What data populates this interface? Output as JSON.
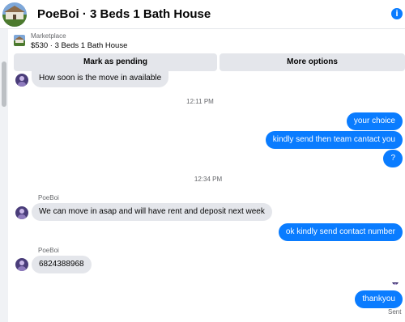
{
  "header": {
    "title": "PoeBoi · 3 Beds 1 Bath House",
    "info_icon": "info-icon"
  },
  "listing": {
    "kicker": "Marketplace",
    "title": "$530 · 3 Beds 1 Bath House"
  },
  "actions": {
    "pending": "Mark as pending",
    "more": "More options"
  },
  "messages": [
    {
      "dir": "in",
      "text": "How soon is the move in available"
    },
    {
      "time": "12:11 PM"
    },
    {
      "dir": "out",
      "text": "your choice"
    },
    {
      "dir": "out",
      "text": "kindly send then team cantact you"
    },
    {
      "dir": "out",
      "text": "?"
    },
    {
      "time": "12:34 PM"
    },
    {
      "sender": "PoeBoi"
    },
    {
      "dir": "in",
      "text": "We can move in asap and will have rent and deposit next week"
    },
    {
      "dir": "out",
      "text": "ok kindly send contact number"
    },
    {
      "sender": "PoeBoi"
    },
    {
      "dir": "in",
      "text": "6824388968"
    },
    {
      "dir": "out",
      "text": "thankyou"
    },
    {
      "status": "Sent"
    }
  ],
  "colors": {
    "accent": "#0a7cff",
    "incoming_bubble": "#e4e6eb",
    "muted_text": "#65676b"
  }
}
